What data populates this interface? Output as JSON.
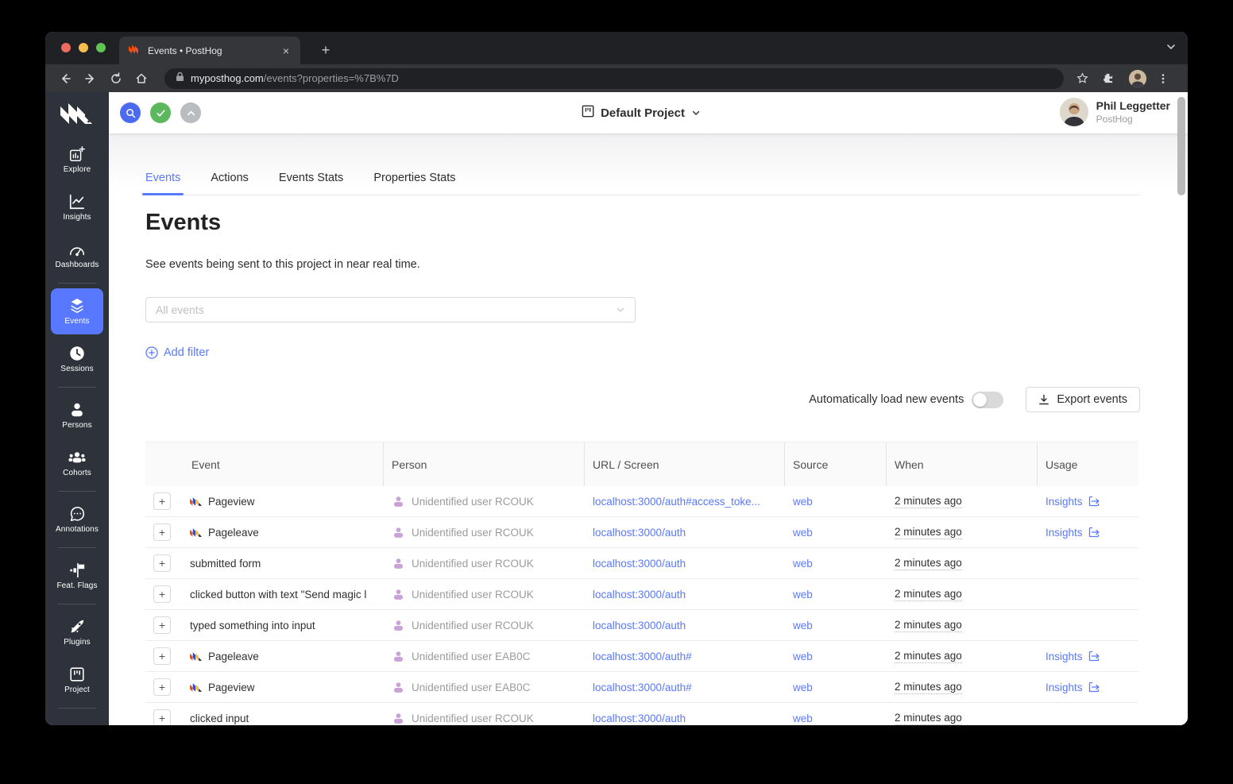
{
  "browser": {
    "tab_title": "Events • PostHog",
    "url_domain": "myposthog.com",
    "url_path": "/events?properties=%7B%7D",
    "new_tab_label": "+",
    "close_tab_label": "×"
  },
  "appbar": {
    "project_name": "Default Project",
    "user_name": "Phil Leggetter",
    "user_org": "PostHog"
  },
  "sidebar": {
    "items": [
      {
        "label": "Explore"
      },
      {
        "label": "Insights"
      },
      {
        "label": "Dashboards"
      },
      {
        "label": "Events"
      },
      {
        "label": "Sessions"
      },
      {
        "label": "Persons"
      },
      {
        "label": "Cohorts"
      },
      {
        "label": "Annotations"
      },
      {
        "label": "Feat. Flags"
      },
      {
        "label": "Plugins"
      },
      {
        "label": "Project"
      }
    ]
  },
  "page": {
    "tabs": [
      {
        "label": "Events"
      },
      {
        "label": "Actions"
      },
      {
        "label": "Events Stats"
      },
      {
        "label": "Properties Stats"
      }
    ],
    "title": "Events",
    "subtitle": "See events being sent to this project in near real time.",
    "filter_placeholder": "All events",
    "add_filter_label": "Add filter",
    "autoload_label": "Automatically load new events",
    "export_label": "Export events"
  },
  "table": {
    "expander": "+",
    "columns": [
      "Event",
      "Person",
      "URL / Screen",
      "Source",
      "When",
      "Usage"
    ],
    "insights_label": "Insights",
    "rows": [
      {
        "event": "Pageview",
        "has_icon": true,
        "person": "Unidentified user RCOUK",
        "url": "localhost:3000/auth#access_toke...",
        "source": "web",
        "when": "2 minutes ago",
        "usage": "Insights"
      },
      {
        "event": "Pageleave",
        "has_icon": true,
        "person": "Unidentified user RCOUK",
        "url": "localhost:3000/auth",
        "source": "web",
        "when": "2 minutes ago",
        "usage": "Insights"
      },
      {
        "event": "submitted form",
        "has_icon": false,
        "person": "Unidentified user RCOUK",
        "url": "localhost:3000/auth",
        "source": "web",
        "when": "2 minutes ago",
        "usage": ""
      },
      {
        "event": "clicked button with text \"Send magic l",
        "has_icon": false,
        "person": "Unidentified user RCOUK",
        "url": "localhost:3000/auth",
        "source": "web",
        "when": "2 minutes ago",
        "usage": ""
      },
      {
        "event": "typed something into input",
        "has_icon": false,
        "person": "Unidentified user RCOUK",
        "url": "localhost:3000/auth",
        "source": "web",
        "when": "2 minutes ago",
        "usage": ""
      },
      {
        "event": "Pageleave",
        "has_icon": true,
        "person": "Unidentified user EAB0C",
        "url": "localhost:3000/auth#",
        "source": "web",
        "when": "2 minutes ago",
        "usage": "Insights"
      },
      {
        "event": "Pageview",
        "has_icon": true,
        "person": "Unidentified user EAB0C",
        "url": "localhost:3000/auth#",
        "source": "web",
        "when": "2 minutes ago",
        "usage": "Insights"
      },
      {
        "event": "clicked input",
        "has_icon": false,
        "person": "Unidentified user RCOUK",
        "url": "localhost:3000/auth",
        "source": "web",
        "when": "2 minutes ago",
        "usage": ""
      }
    ]
  },
  "colors": {
    "accent_blue": "#5879ff",
    "sidebar_bg": "#2e333b",
    "chrome_dark": "#202124",
    "chrome_mid": "#35363a",
    "person_purple": "#c9a2d8",
    "posthog_orange": "#f54e00",
    "posthog_blue": "#1d4aff",
    "posthog_yellow": "#f9bd2b"
  }
}
